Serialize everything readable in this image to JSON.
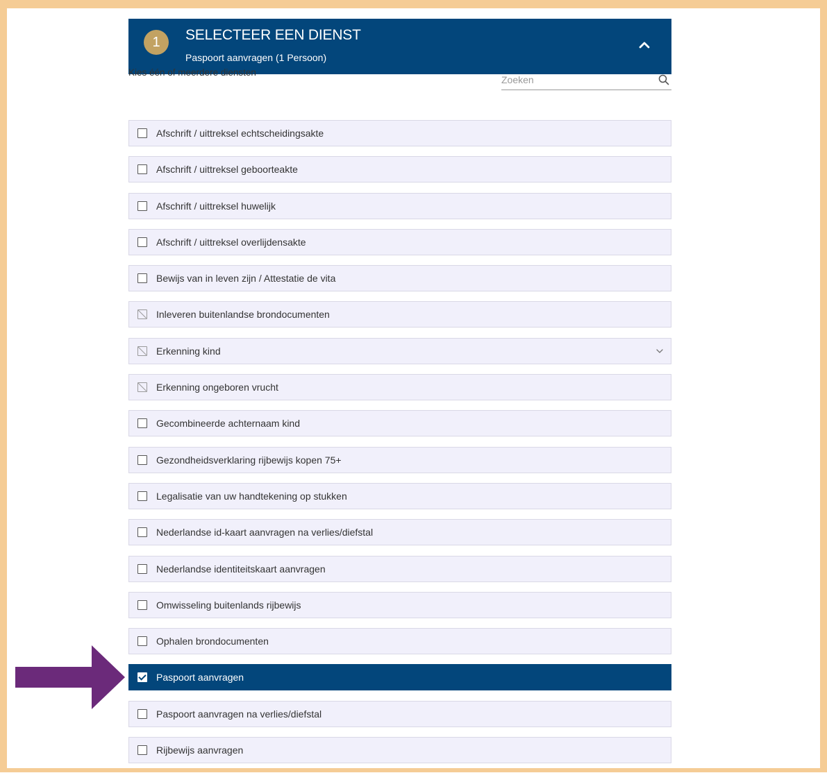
{
  "header": {
    "step_number": "1",
    "title": "SELECTEER EEN DIENST",
    "subtitle": "Paspoort aanvragen (1 Persoon)",
    "collapse_icon": "chevron-up-icon"
  },
  "intro": {
    "label": "Kies één of meerdere diensten"
  },
  "search": {
    "placeholder": "Zoeken",
    "icon": "search-icon"
  },
  "services": [
    {
      "label": "Afschrift / uittreksel echtscheidingsakte",
      "state": "unchecked"
    },
    {
      "label": "Afschrift / uittreksel geboorteakte",
      "state": "unchecked"
    },
    {
      "label": "Afschrift / uittreksel huwelijk",
      "state": "unchecked"
    },
    {
      "label": "Afschrift / uittreksel overlijdensakte",
      "state": "unchecked"
    },
    {
      "label": "Bewijs van in leven zijn / Attestatie de vita",
      "state": "unchecked"
    },
    {
      "label": "Inleveren buitenlandse brondocumenten",
      "state": "disabled"
    },
    {
      "label": "Erkenning kind",
      "state": "disabled",
      "expandable": true
    },
    {
      "label": "Erkenning ongeboren vrucht",
      "state": "disabled"
    },
    {
      "label": "Gecombineerde achternaam kind",
      "state": "unchecked"
    },
    {
      "label": "Gezondheidsverklaring rijbewijs kopen 75+",
      "state": "unchecked"
    },
    {
      "label": "Legalisatie van uw handtekening op stukken",
      "state": "unchecked"
    },
    {
      "label": "Nederlandse id-kaart aanvragen na verlies/diefstal",
      "state": "unchecked"
    },
    {
      "label": "Nederlandse identiteitskaart aanvragen",
      "state": "unchecked"
    },
    {
      "label": "Omwisseling buitenlands rijbewijs",
      "state": "unchecked"
    },
    {
      "label": "Ophalen brondocumenten",
      "state": "unchecked"
    },
    {
      "label": "Paspoort aanvragen",
      "state": "checked"
    },
    {
      "label": "Paspoort aanvragen na verlies/diefstal",
      "state": "unchecked"
    },
    {
      "label": "Rijbewijs aanvragen",
      "state": "unchecked"
    }
  ],
  "colors": {
    "header_bg": "#03467b",
    "badge_bg": "#c2a262",
    "frame_border": "#f5cc95",
    "arrow": "#6b2a7a",
    "item_bg": "#f1f0fb"
  }
}
